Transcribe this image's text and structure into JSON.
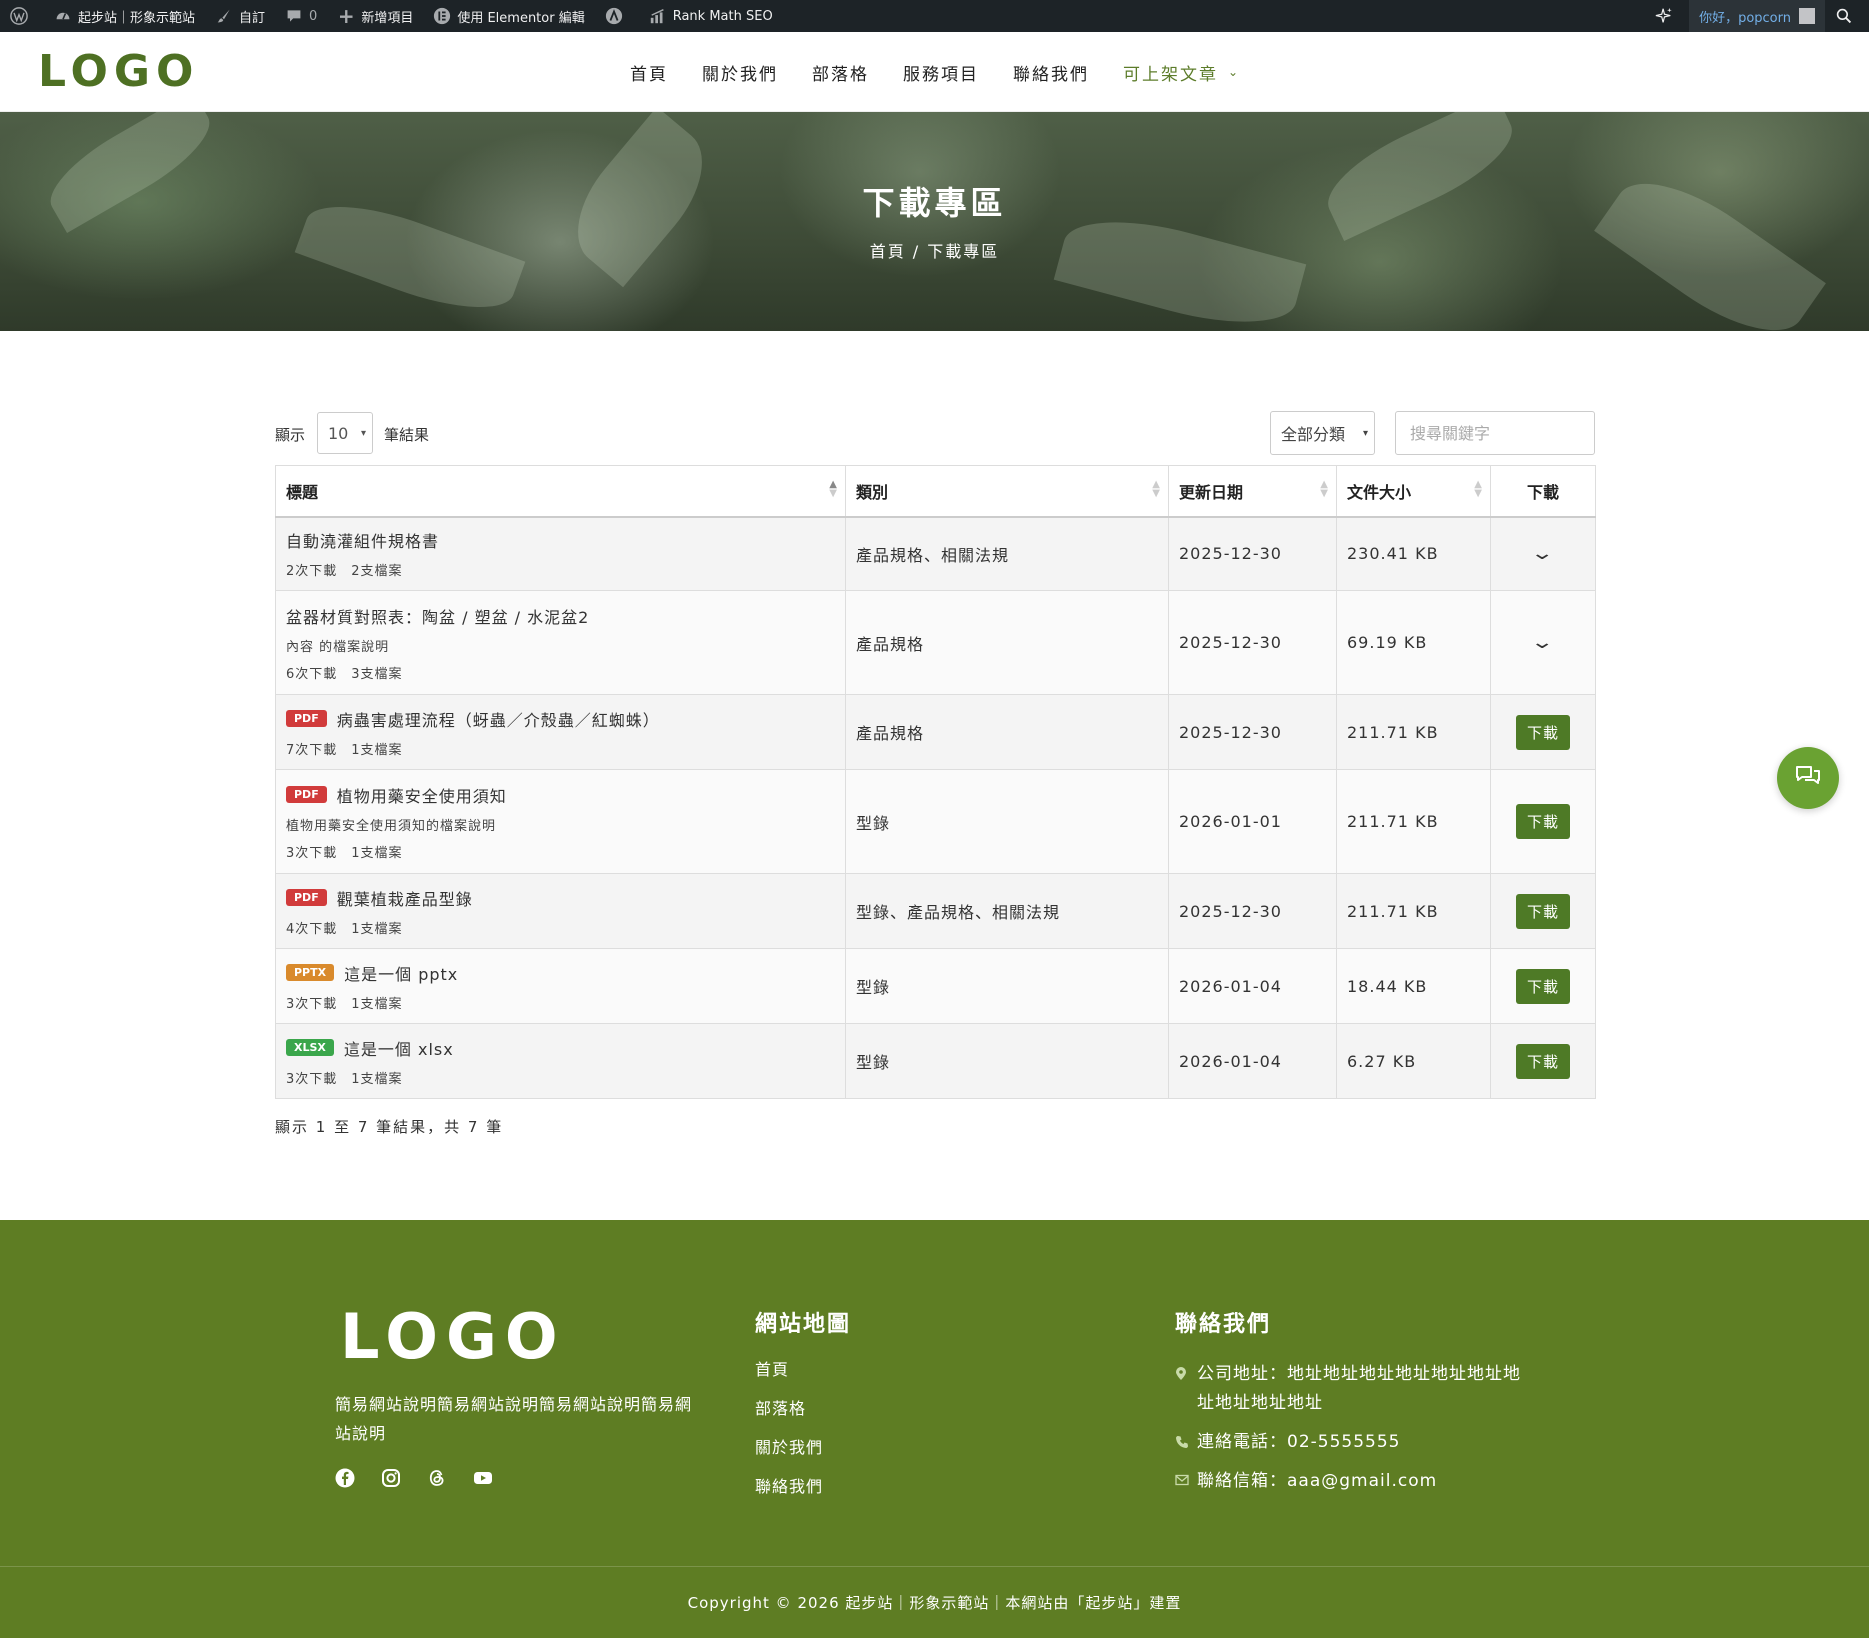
{
  "admin_bar": {
    "site_name": "起步站｜形象示範站",
    "customize": "自訂",
    "comments_count": "0",
    "new_item": "新增項目",
    "elementor": "使用 Elementor 編輯",
    "rank_math": "Rank Math SEO",
    "howdy": "你好，popcorn"
  },
  "header": {
    "logo": "LOGO",
    "nav": [
      {
        "label": "首頁"
      },
      {
        "label": "關於我們"
      },
      {
        "label": "部落格"
      },
      {
        "label": "服務項目"
      },
      {
        "label": "聯絡我們"
      },
      {
        "label": "可上架文章",
        "active": true
      }
    ]
  },
  "hero": {
    "title": "下載專區",
    "breadcrumb": "首頁 / 下載專區"
  },
  "controls": {
    "show_label": "顯示",
    "page_length": "10",
    "show_suffix": "筆結果",
    "category": "全部分類",
    "search_placeholder": "搜尋關鍵字"
  },
  "table": {
    "headers": {
      "title": "標題",
      "category": "類別",
      "date": "更新日期",
      "size": "文件大小",
      "download": "下載"
    },
    "download_label": "下載",
    "rows": [
      {
        "badge": "",
        "title": "自動澆灌組件規格書",
        "desc": "",
        "downloads": "2次下載",
        "files": "2支檔案",
        "category": "產品規格、相關法規",
        "date": "2025-12-30",
        "size": "230.41 KB",
        "action": "expand"
      },
      {
        "badge": "",
        "title": "盆器材質對照表：陶盆 / 塑盆 / 水泥盆2",
        "desc": "內容 的檔案說明",
        "downloads": "6次下載",
        "files": "3支檔案",
        "category": "產品規格",
        "date": "2025-12-30",
        "size": "69.19 KB",
        "action": "expand"
      },
      {
        "badge": "PDF",
        "title": "病蟲害處理流程（蚜蟲／介殼蟲／紅蜘蛛）",
        "desc": "",
        "downloads": "7次下載",
        "files": "1支檔案",
        "category": "產品規格",
        "date": "2025-12-30",
        "size": "211.71 KB",
        "action": "button"
      },
      {
        "badge": "PDF",
        "title": "植物用藥安全使用須知",
        "desc": "植物用藥安全使用須知的檔案說明",
        "downloads": "3次下載",
        "files": "1支檔案",
        "category": "型錄",
        "date": "2026-01-01",
        "size": "211.71 KB",
        "action": "button"
      },
      {
        "badge": "PDF",
        "title": "觀葉植栽產品型錄",
        "desc": "",
        "downloads": "4次下載",
        "files": "1支檔案",
        "category": "型錄、產品規格、相關法規",
        "date": "2025-12-30",
        "size": "211.71 KB",
        "action": "button"
      },
      {
        "badge": "PPTX",
        "title": "這是一個 pptx",
        "desc": "",
        "downloads": "3次下載",
        "files": "1支檔案",
        "category": "型錄",
        "date": "2026-01-04",
        "size": "18.44 KB",
        "action": "button"
      },
      {
        "badge": "XLSX",
        "title": "這是一個 xlsx",
        "desc": "",
        "downloads": "3次下載",
        "files": "1支檔案",
        "category": "型錄",
        "date": "2026-01-04",
        "size": "6.27 KB",
        "action": "button"
      }
    ],
    "info": "顯示 1 至 7 筆結果，共 7 筆"
  },
  "badge_colors": {
    "PDF": "#d13b3b",
    "PPTX": "#d98a2c",
    "XLSX": "#3aa64b"
  },
  "footer": {
    "logo": "LOGO",
    "description": "簡易網站說明簡易網站說明簡易網站說明簡易網站說明",
    "sitemap_title": "網站地圖",
    "sitemap_links": [
      "首頁",
      "部落格",
      "關於我們",
      "聯絡我們"
    ],
    "contact_title": "聯絡我們",
    "address": "公司地址：地址地址地址地址地址地址地址地址地址地址",
    "phone": "連絡電話：02-5555555",
    "email": "聯絡信箱：aaa@gmail.com",
    "copyright": "Copyright © 2026 起步站｜形象示範站｜本網站由「起步站」建置"
  },
  "colors": {
    "brand_green": "#5e7d23",
    "logo_green": "#4e7023",
    "button_green": "#4e7a26"
  }
}
